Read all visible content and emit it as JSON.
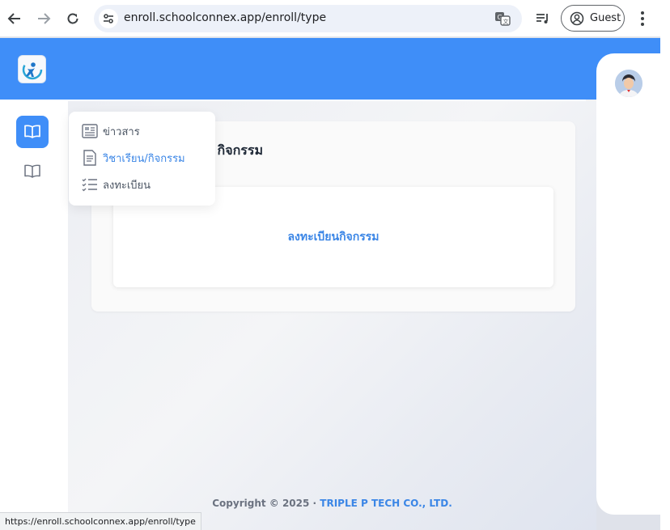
{
  "browser": {
    "url": "enroll.schoolconnex.app/enroll/type",
    "profile_label": "Guest",
    "status_url": "https://enroll.schoolconnex.app/enroll/type",
    "icons": [
      "back-icon",
      "forward-icon",
      "reload-icon",
      "site-settings-icon",
      "translate-icon",
      "media-control-icon",
      "profile-icon",
      "more-menu-icon"
    ]
  },
  "app": {
    "brand_color": "#3f8ef8",
    "accent_color": "#3b86e6"
  },
  "sidebar": {
    "items": [
      {
        "icon": "book-open-icon",
        "active": true
      },
      {
        "icon": "book-open-icon",
        "active": false
      }
    ]
  },
  "dropdown": {
    "items": [
      {
        "label": "ข่าวสาร",
        "icon": "newspaper-icon",
        "active": false
      },
      {
        "label": "วิชาเรียน/กิจกรรม",
        "icon": "document-icon",
        "active": true
      },
      {
        "label": "ลงทะเบียน",
        "icon": "checklist-icon",
        "active": false
      }
    ]
  },
  "main": {
    "card_title": "กิจกรรม",
    "register_link": "ลงทะเบียนกิจกรรม"
  },
  "footer": {
    "copyright": "Copyright © 2025 · ",
    "company": "TRIPLE P TECH CO., LTD."
  }
}
